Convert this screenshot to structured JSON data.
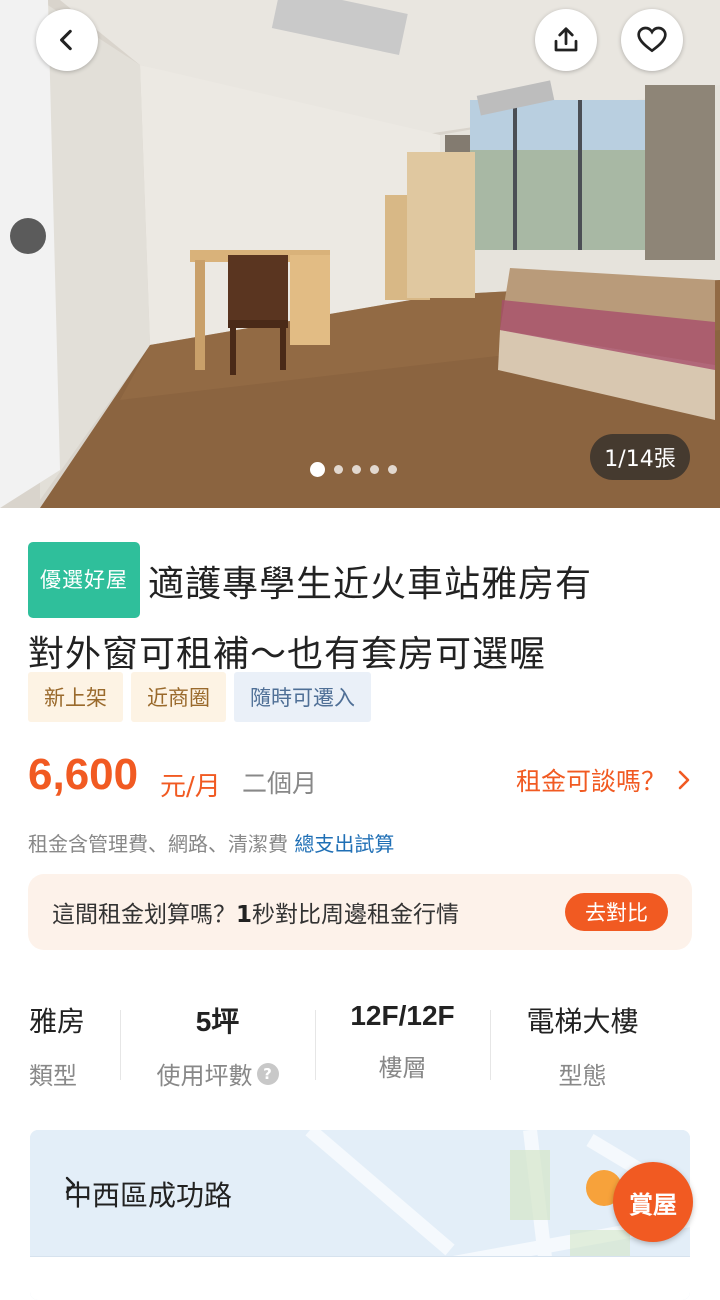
{
  "hero": {
    "photo_counter": "1/14張",
    "dots_total": 5,
    "dots_active_index": 0
  },
  "listing": {
    "premium_badge": "優選好屋",
    "title_line1": "適護專學生近火車站雅房有",
    "title_line2": "對外窗可租補～也有套房可選喔",
    "tags": [
      "新上架",
      "近商圈",
      "隨時可遷入"
    ]
  },
  "price": {
    "amount": "6,600",
    "unit": "元/月",
    "term": "二個月",
    "negotiate_label": "租金可談嗎？"
  },
  "fees": {
    "note": "租金含管理費、網路、清潔費",
    "link": "總支出試算"
  },
  "compare": {
    "text_before": "這間租金划算嗎？",
    "text_bold": "1",
    "text_after": "秒對比周邊租金行情",
    "button": "去對比"
  },
  "specs": [
    {
      "value": "雅房",
      "label": "類型"
    },
    {
      "value": "5坪",
      "label": "使用坪數"
    },
    {
      "value": "12F/12F",
      "label": "樓層"
    },
    {
      "value": "電梯大樓",
      "label": "型態"
    }
  ],
  "map": {
    "address": "中西區成功路",
    "visit_button": "賞屋"
  },
  "colors": {
    "accent": "#f15a22",
    "premium_badge": "#2fbf9b",
    "link": "#1f6fb5"
  }
}
